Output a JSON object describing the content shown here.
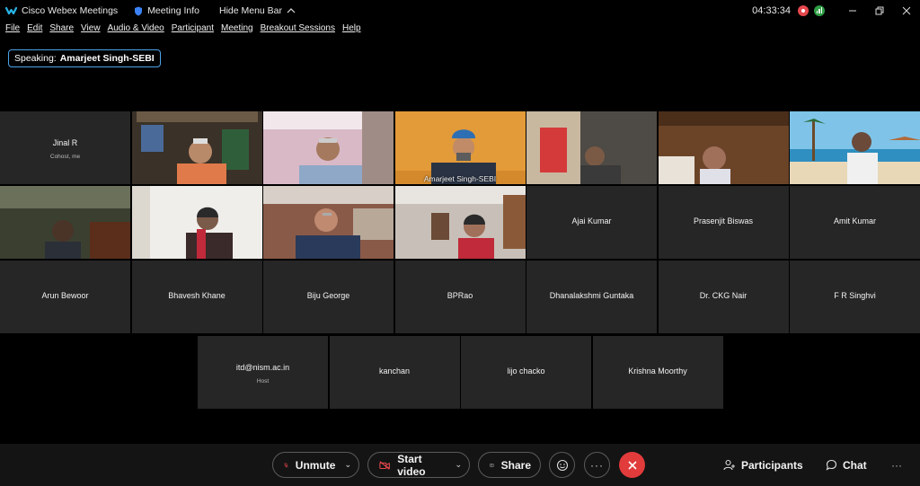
{
  "titlebar": {
    "app_title": "Cisco Webex Meetings",
    "meeting_info": "Meeting Info",
    "hide_menu": "Hide Menu Bar",
    "clock": "04:33:34",
    "icons": [
      "webex-logo-icon",
      "shield-icon",
      "chevron-up-icon",
      "record-icon",
      "network-icon",
      "minimize-icon",
      "restore-icon",
      "close-icon"
    ]
  },
  "menu": [
    "File",
    "Edit",
    "Share",
    "View",
    "Audio & Video",
    "Participant",
    "Meeting",
    "Breakout Sessions",
    "Help"
  ],
  "speaking": {
    "prefix": "Speaking:",
    "name": "Amarjeet Singh-SEBI"
  },
  "participants": [
    {
      "name": "Jinal R",
      "sub": "Cohost, me",
      "video": false
    },
    {
      "name": "",
      "video": true,
      "scene": "bookshelf"
    },
    {
      "name": "",
      "video": true,
      "scene": "pinkroom"
    },
    {
      "name": "Amarjeet Singh-SEBI",
      "video": true,
      "scene": "turban",
      "active": true
    },
    {
      "name": "",
      "video": true,
      "scene": "painting"
    },
    {
      "name": "",
      "video": true,
      "scene": "wood"
    },
    {
      "name": "",
      "video": true,
      "scene": "beach"
    },
    {
      "name": "",
      "video": true,
      "scene": "greenwall"
    },
    {
      "name": "",
      "video": true,
      "scene": "whitewall"
    },
    {
      "name": "",
      "video": true,
      "scene": "office"
    },
    {
      "name": "",
      "video": true,
      "scene": "shelf"
    },
    {
      "name": "Ajai Kumar",
      "video": false
    },
    {
      "name": "Prasenjit Biswas",
      "video": false
    },
    {
      "name": "Amit Kumar",
      "video": false
    },
    {
      "name": "Arun Bewoor",
      "video": false
    },
    {
      "name": "Bhavesh Khane",
      "video": false
    },
    {
      "name": "Biju George",
      "video": false
    },
    {
      "name": "BPRao",
      "video": false
    },
    {
      "name": "Dhanalakshmi Guntaka",
      "video": false
    },
    {
      "name": "Dr. CKG Nair",
      "video": false
    },
    {
      "name": "F R Singhvi",
      "video": false
    },
    {
      "name": "itd@nism.ac.in",
      "sub": "Host",
      "video": false
    },
    {
      "name": "kanchan",
      "video": false
    },
    {
      "name": "lijo chacko",
      "video": false
    },
    {
      "name": "Krishna Moorthy",
      "video": false
    }
  ],
  "toolbar": {
    "unmute": "Unmute",
    "start_video": "Start video",
    "share": "Share",
    "participants": "Participants",
    "chat": "Chat"
  },
  "colors": {
    "accent": "#2aa3f0",
    "leave": "#e23b3b",
    "tile": "#262626"
  }
}
